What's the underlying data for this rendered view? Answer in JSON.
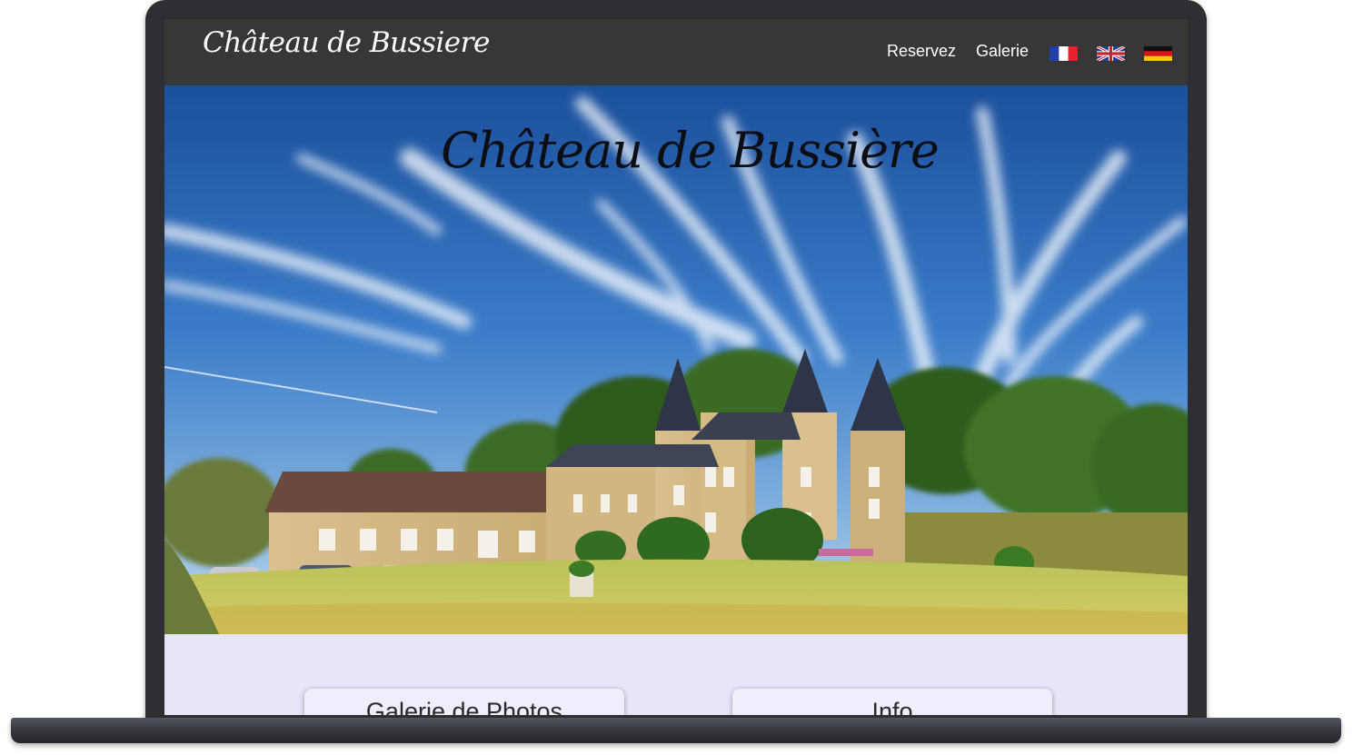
{
  "navbar": {
    "brand": "Château de Bussiere",
    "links": [
      {
        "label": "Reservez"
      },
      {
        "label": "Galerie"
      }
    ],
    "languages": [
      {
        "name": "flag-france-icon"
      },
      {
        "name": "flag-uk-icon"
      },
      {
        "name": "flag-germany-icon"
      }
    ]
  },
  "hero": {
    "title": "Château de Bussière"
  },
  "cards": [
    {
      "label": "Galerie de Photos"
    },
    {
      "label": "Info"
    }
  ],
  "colors": {
    "navbar_bg": "#373737",
    "content_bg": "#e7e6f7",
    "device_frame": "#2e2f33"
  }
}
